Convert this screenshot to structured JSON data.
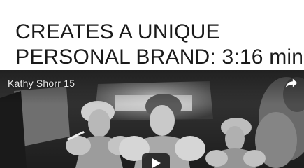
{
  "headline": {
    "line1": "CREATES A UNIQUE",
    "line2": "PERSONAL BRAND:  3:16 min."
  },
  "video": {
    "title": "Kathy Shorr 15",
    "controls": {
      "share_icon": "share-icon",
      "play_icon": "play-icon"
    },
    "colors": {
      "overlay_text": "#e9e9e9",
      "play_button_bg": "#181818"
    }
  }
}
